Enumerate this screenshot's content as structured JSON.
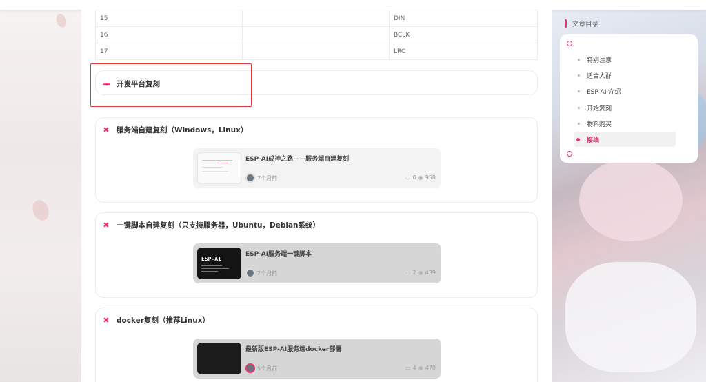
{
  "pin_table": {
    "rows": [
      [
        "15",
        "",
        "DIN"
      ],
      [
        "16",
        "",
        "BCLK"
      ],
      [
        "17",
        "",
        "LRC"
      ]
    ]
  },
  "section_open_platform": {
    "title": "开发平台复刻"
  },
  "section_server_build": {
    "title": "服务端自建复刻（Windows，Linux）",
    "post": {
      "title": "ESP-AI成神之路——服务端自建复刻",
      "time": "7个月前",
      "comments": "0",
      "views": "958"
    }
  },
  "section_script_build": {
    "title": "一键脚本自建复刻（只支持服务器，Ubuntu，Debian系统）",
    "post": {
      "title": "ESP-AI服务端一键脚本",
      "time": "7个月前",
      "comments": "2",
      "views": "439",
      "thumb_text": "ESP-AI"
    }
  },
  "section_docker": {
    "title": "docker复刻（推荐Linux）",
    "post": {
      "title": "最新版ESP-AI服务端docker部署",
      "time": "5个月前",
      "comments": "4",
      "views": "470"
    }
  },
  "toc": {
    "title": "文章目录",
    "items": [
      {
        "label": "特别注意",
        "active": false
      },
      {
        "label": "适合人群",
        "active": false
      },
      {
        "label": "ESP-AI 介绍",
        "active": false
      },
      {
        "label": "开始复刻",
        "active": false
      },
      {
        "label": "物料购买",
        "active": false
      },
      {
        "label": "接线",
        "active": true
      }
    ]
  },
  "colors": {
    "accent": "#e8336f",
    "highlight_border": "#e03b3b"
  },
  "icons": {
    "section": "close-x-icon",
    "open_section": "bar-t-icon",
    "comment": "comment-icon",
    "views": "eye-icon"
  }
}
